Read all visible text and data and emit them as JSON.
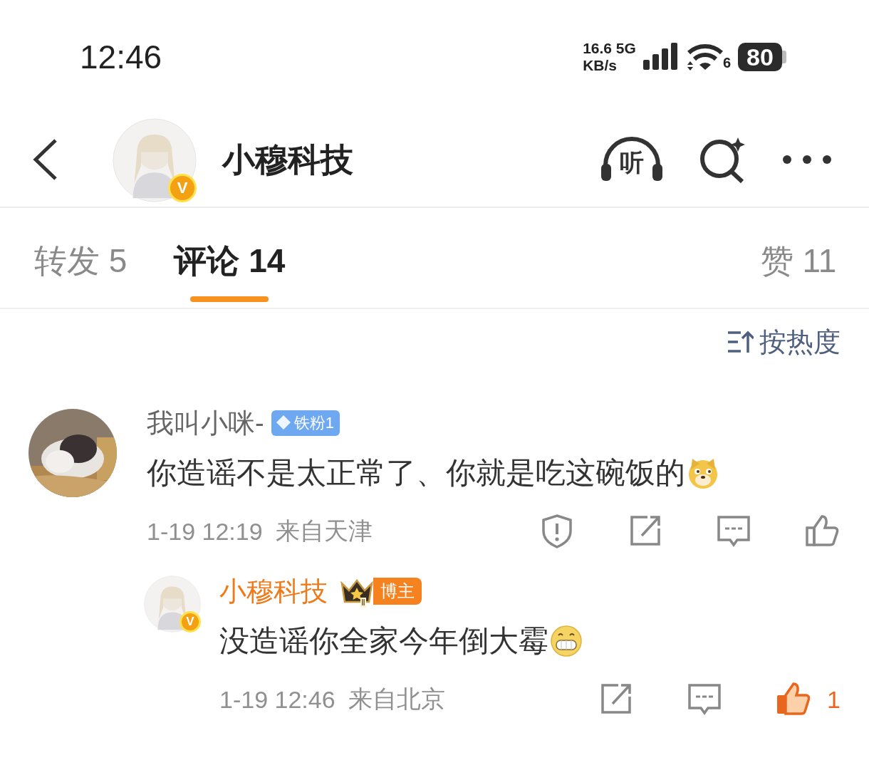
{
  "status_bar": {
    "time": "12:46",
    "speed": "16.6",
    "speed_unit": "KB/s",
    "network": "5G",
    "wifi_label": "6",
    "battery": "80"
  },
  "header": {
    "title": "小穆科技",
    "verified_mark": "V",
    "listen_label": "听"
  },
  "tabs": [
    {
      "label": "转发 5",
      "selected": false
    },
    {
      "label": "评论 14",
      "selected": true
    },
    {
      "label": "赞 11",
      "selected": false
    }
  ],
  "sort": {
    "label": "按热度"
  },
  "comments": [
    {
      "kind": "fan",
      "name": "我叫小咪-",
      "badge": "铁粉1",
      "text": "你造谣不是太正常了、你就是吃这碗饭的",
      "emoji": {
        "kind": "doge"
      },
      "time": "1-19 12:19",
      "location": "来自天津",
      "actions": [
        {
          "kind": "report"
        },
        {
          "kind": "share"
        },
        {
          "kind": "comment"
        },
        {
          "kind": "like"
        }
      ],
      "liked": false
    },
    {
      "kind": "author",
      "name": "小穆科技",
      "verified_mark": "V",
      "crown_level": "Ⅱ",
      "badge": "博主",
      "text": "没造谣你全家今年倒大霉",
      "emoji": {
        "kind": "grin"
      },
      "time": "1-19 12:46",
      "location": "来自北京",
      "actions": [
        {
          "kind": "share"
        },
        {
          "kind": "comment"
        },
        {
          "kind": "like"
        }
      ],
      "liked": true,
      "like_count": "1"
    }
  ]
}
